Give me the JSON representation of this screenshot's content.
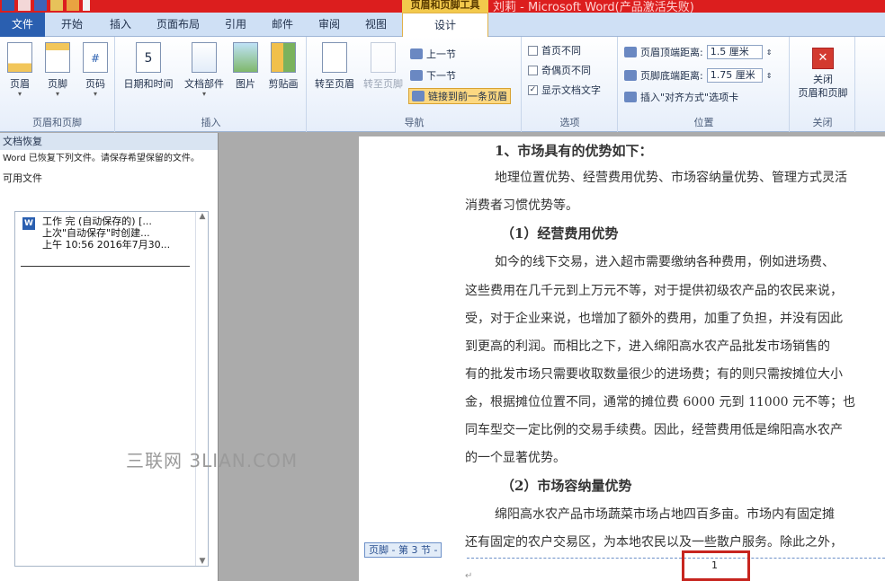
{
  "window": {
    "title": "刘莉 - Microsoft Word(产品激活失败)",
    "context_tool": "页眉和页脚工具",
    "title_bar_color": "#dc1e1e"
  },
  "tabs": [
    {
      "label": "文件",
      "active": false
    },
    {
      "label": "开始",
      "active": false
    },
    {
      "label": "插入",
      "active": false
    },
    {
      "label": "页面布局",
      "active": false
    },
    {
      "label": "引用",
      "active": false
    },
    {
      "label": "邮件",
      "active": false
    },
    {
      "label": "审阅",
      "active": false
    },
    {
      "label": "视图",
      "active": false
    },
    {
      "label": "设计",
      "active": true
    }
  ],
  "ribbon": {
    "header_footer": {
      "label": "页眉和页脚",
      "header": "页眉",
      "footer": "页脚",
      "page_number": "页码"
    },
    "insert": {
      "label": "插入",
      "datetime": "日期和时间",
      "docparts": "文档部件",
      "picture": "图片",
      "clipart": "剪贴画"
    },
    "navigation": {
      "label": "导航",
      "goto_header": "转至页眉",
      "goto_footer": "转至页脚",
      "prev": "上一节",
      "next": "下一节",
      "link_prev": "链接到前一条页眉"
    },
    "options": {
      "label": "选项",
      "first_page": "首页不同",
      "odd_even": "奇偶页不同",
      "show_text": "显示文档文字"
    },
    "position": {
      "label": "位置",
      "header_dist_label": "页眉顶端距离:",
      "header_dist": "1.5 厘米",
      "footer_dist_label": "页脚底端距离:",
      "footer_dist": "1.75 厘米",
      "insert_align": "插入\"对齐方式\"选项卡"
    },
    "close": {
      "label": "关闭",
      "button": "关闭\n页眉和页脚"
    }
  },
  "recovery_pane": {
    "title": "文档恢复",
    "description": "Word 已恢复下列文件。请保存希望保留的文件。",
    "available": "可用文件",
    "file": {
      "name": "工作 完 (自动保存的) [...",
      "line2": "上次\"自动保存\"时创建...",
      "line3": "上午 10:56 2016年7月30..."
    }
  },
  "document": {
    "lines": [
      "1、市场具有的优势如下：",
      "地理位置优势、经营费用优势、市场容纳量优势、管理方式灵活",
      "消费者习惯优势等。",
      "（1）经营费用优势",
      "如今的线下交易，进入超市需要缴纳各种费用，例如进场费、",
      "这些费用在几千元到上万元不等，对于提供初级农产品的农民来说，",
      "受，对于企业来说，也增加了额外的费用，加重了负担，并没有因此",
      "到更高的利润。而相比之下，进入绵阳高水农产品批发市场销售的",
      "有的批发市场只需要收取数量很少的进场费；有的则只需按摊位大小",
      "金，根据摊位位置不同，通常的摊位费 6000 元到 11000 元不等；也",
      "同车型交一定比例的交易手续费。因此，经营费用低是绵阳高水农产",
      "的一个显著优势。",
      "（2）市场容纳量优势",
      "绵阳高水农产品市场蔬菜市场占地四百多亩。市场内有固定摊",
      "还有固定的农户交易区，为本地农民以及一些散户服务。除此之外，"
    ],
    "footer_tag": "页脚 - 第 3 节 -",
    "page_number": "1"
  },
  "watermark": "三联网 3LIAN.COM"
}
